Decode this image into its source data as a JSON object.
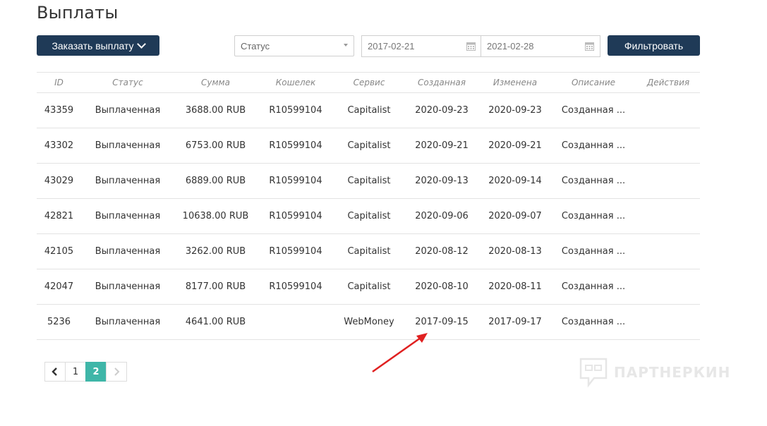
{
  "page": {
    "title": "Выплаты"
  },
  "toolbar": {
    "order_label": "Заказать выплату",
    "status_placeholder": "Статус",
    "date_from": "2017-02-21",
    "date_to": "2021-02-28",
    "filter_label": "Фильтровать"
  },
  "table": {
    "headers": [
      "ID",
      "Статус",
      "Сумма",
      "Кошелек",
      "Сервис",
      "Созданная",
      "Изменена",
      "Описание",
      "Действия"
    ],
    "rows": [
      [
        "43359",
        "Выплаченная",
        "3688.00 RUB",
        "R10599104",
        "Capitalist",
        "2020-09-23",
        "2020-09-23",
        "Созданная ...",
        ""
      ],
      [
        "43302",
        "Выплаченная",
        "6753.00 RUB",
        "R10599104",
        "Capitalist",
        "2020-09-21",
        "2020-09-21",
        "Созданная ...",
        ""
      ],
      [
        "43029",
        "Выплаченная",
        "6889.00 RUB",
        "R10599104",
        "Capitalist",
        "2020-09-13",
        "2020-09-14",
        "Созданная ...",
        ""
      ],
      [
        "42821",
        "Выплаченная",
        "10638.00 RUB",
        "R10599104",
        "Capitalist",
        "2020-09-06",
        "2020-09-07",
        "Созданная ...",
        ""
      ],
      [
        "42105",
        "Выплаченная",
        "3262.00 RUB",
        "R10599104",
        "Capitalist",
        "2020-08-12",
        "2020-08-13",
        "Созданная ...",
        ""
      ],
      [
        "42047",
        "Выплаченная",
        "8177.00 RUB",
        "R10599104",
        "Capitalist",
        "2020-08-10",
        "2020-08-11",
        "Созданная ...",
        ""
      ],
      [
        "5236",
        "Выплаченная",
        "4641.00 RUB",
        "",
        "WebMoney",
        "2017-09-15",
        "2017-09-17",
        "Созданная ...",
        ""
      ]
    ]
  },
  "pagination": {
    "pages": [
      "1",
      "2"
    ],
    "current": "2"
  },
  "watermark": {
    "text": "ПАРТНЕРКИН"
  },
  "colors": {
    "primary": "#1f3a57",
    "active_page": "#3fb6a8",
    "annotation_arrow": "#e02020"
  }
}
